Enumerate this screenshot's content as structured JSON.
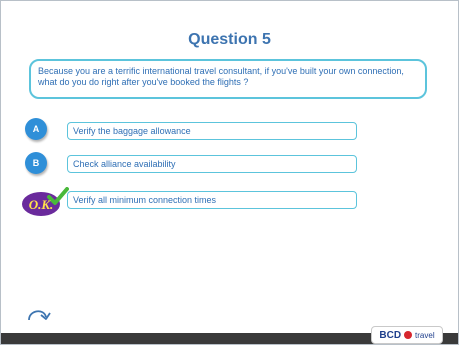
{
  "quiz": {
    "title": "Question 5",
    "question": "Because you are a terrific international travel consultant,  if you've built your own connection, what do you do right after you've booked the flights ?",
    "options": [
      {
        "badge": "A",
        "text": "Verify the baggage allowance"
      },
      {
        "badge": "B",
        "text": "Check alliance availability"
      },
      {
        "badge": "O.K.",
        "text": "Verify all minimum connection  times",
        "correct": true
      }
    ]
  },
  "footer": {
    "logo_main": "BCD",
    "logo_sub": "travel"
  },
  "icons": {
    "replay": "replay-arrow-icon",
    "correct": "ok-check-icon"
  },
  "colors": {
    "title": "#3d74b0",
    "text": "#2f6fb5",
    "border": "#5cc4dc",
    "badge": "#2f8fd8",
    "ok_purple": "#6a2a9c",
    "ok_green": "#49b83a",
    "logo_blue": "#1f3f8c",
    "logo_red": "#d6262e",
    "footer_bg": "#3a3a3a"
  }
}
